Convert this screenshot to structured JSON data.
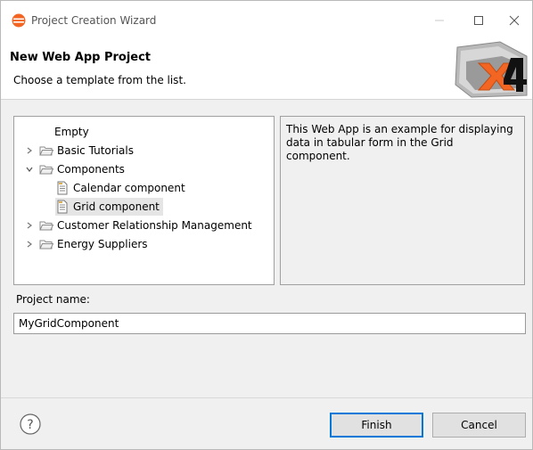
{
  "window": {
    "title": "Project Creation Wizard"
  },
  "header": {
    "title": "New Web App Project",
    "subtitle": "Choose a template from the list."
  },
  "tree": {
    "items": [
      {
        "label": "Empty"
      },
      {
        "label": "Basic Tutorials"
      },
      {
        "label": "Components"
      },
      {
        "label": "Calendar component"
      },
      {
        "label": "Grid component"
      },
      {
        "label": "Customer Relationship Management"
      },
      {
        "label": "Energy Suppliers"
      }
    ]
  },
  "description": {
    "text": "This Web App is an example for displaying data in tabular form in the Grid component."
  },
  "project_name": {
    "label": "Project name:",
    "value": "MyGridComponent"
  },
  "footer": {
    "finish_label": "Finish",
    "cancel_label": "Cancel"
  },
  "colors": {
    "accent": "#0078d7",
    "folder": "#d9b15a",
    "app_icon": "#f26522"
  }
}
